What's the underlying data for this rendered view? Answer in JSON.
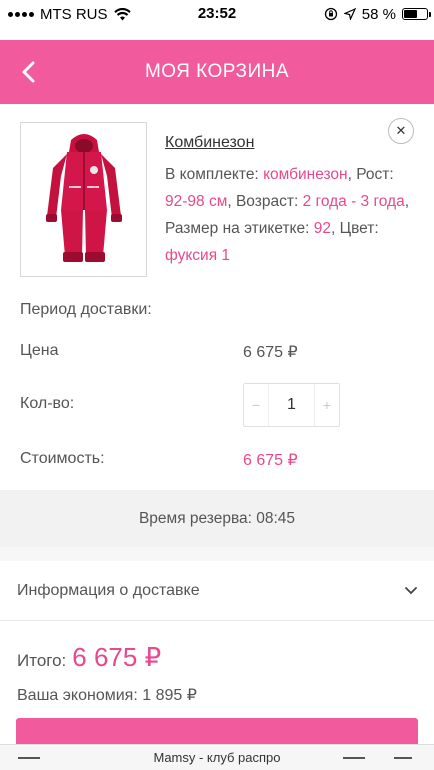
{
  "status_bar": {
    "carrier": "MTS RUS",
    "time": "23:52",
    "battery_percent": "58 %",
    "battery_level": 0.58
  },
  "header": {
    "title": "МОЯ КОРЗИНА",
    "back_icon": "chevron-left-icon",
    "background_color": "#f15a9c"
  },
  "product": {
    "name": "Комбинезон",
    "remove_icon": "close-icon",
    "desc": {
      "set_label": "В комплекте: ",
      "set_value": "комбинезон",
      "height_label": ", Рост: ",
      "height_value": "92-98 см",
      "age_label": ", Возраст: ",
      "age_value": "2 года - 3 года",
      "size_label": ", Размер на этикетке: ",
      "size_value": "92",
      "color_label": ", Цвет: ",
      "color_value": "фуксия 1"
    },
    "delivery_period_label": "Период доставки:",
    "price_label": "Цена",
    "price_value": "6 675 ₽",
    "qty_label": "Кол-во:",
    "qty_minus": "−",
    "qty_value": "1",
    "qty_plus": "+",
    "cost_label": "Стоимость:",
    "cost_value": "6 675 ₽"
  },
  "reserve": {
    "text": "Время резерва: 08:45"
  },
  "delivery_info": {
    "label": "Информация о доставке",
    "icon": "chevron-down-icon"
  },
  "total": {
    "label": "Итого:",
    "amount": "6 675 ₽",
    "savings": "Ваша экономия: 1 895 ₽"
  },
  "bottom_bar": {
    "title": "Mamsy - клуб распро"
  },
  "colors": {
    "accent": "#f15a9c",
    "price_pink": "#e8488e"
  }
}
